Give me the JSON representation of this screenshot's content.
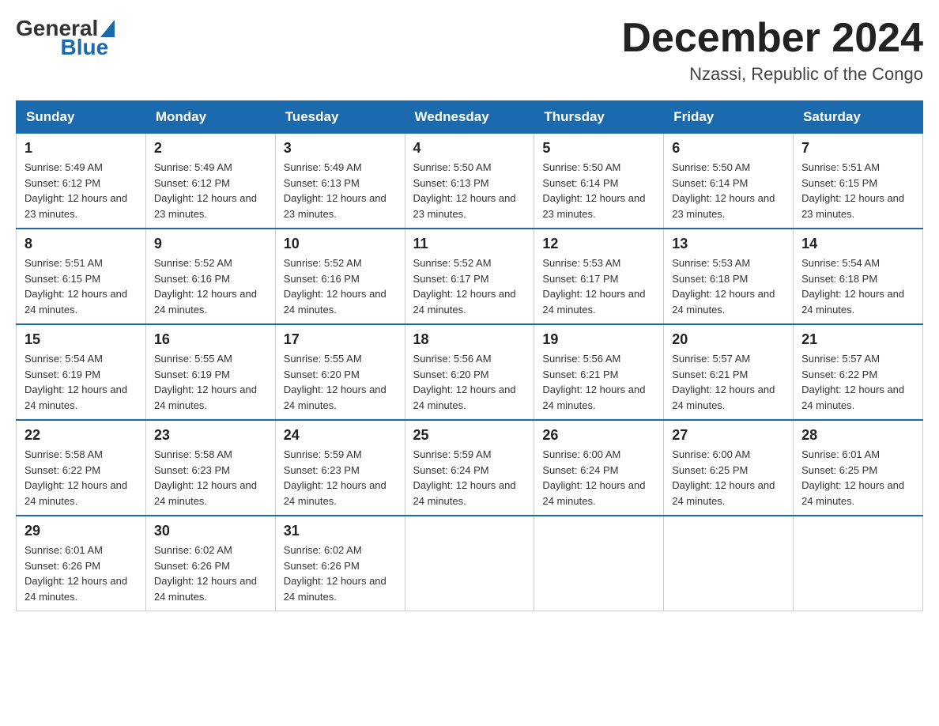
{
  "logo": {
    "general": "General",
    "blue": "Blue"
  },
  "header": {
    "month": "December 2024",
    "location": "Nzassi, Republic of the Congo"
  },
  "weekdays": [
    "Sunday",
    "Monday",
    "Tuesday",
    "Wednesday",
    "Thursday",
    "Friday",
    "Saturday"
  ],
  "weeks": [
    [
      {
        "day": "1",
        "sunrise": "5:49 AM",
        "sunset": "6:12 PM",
        "daylight": "12 hours and 23 minutes."
      },
      {
        "day": "2",
        "sunrise": "5:49 AM",
        "sunset": "6:12 PM",
        "daylight": "12 hours and 23 minutes."
      },
      {
        "day": "3",
        "sunrise": "5:49 AM",
        "sunset": "6:13 PM",
        "daylight": "12 hours and 23 minutes."
      },
      {
        "day": "4",
        "sunrise": "5:50 AM",
        "sunset": "6:13 PM",
        "daylight": "12 hours and 23 minutes."
      },
      {
        "day": "5",
        "sunrise": "5:50 AM",
        "sunset": "6:14 PM",
        "daylight": "12 hours and 23 minutes."
      },
      {
        "day": "6",
        "sunrise": "5:50 AM",
        "sunset": "6:14 PM",
        "daylight": "12 hours and 23 minutes."
      },
      {
        "day": "7",
        "sunrise": "5:51 AM",
        "sunset": "6:15 PM",
        "daylight": "12 hours and 23 minutes."
      }
    ],
    [
      {
        "day": "8",
        "sunrise": "5:51 AM",
        "sunset": "6:15 PM",
        "daylight": "12 hours and 24 minutes."
      },
      {
        "day": "9",
        "sunrise": "5:52 AM",
        "sunset": "6:16 PM",
        "daylight": "12 hours and 24 minutes."
      },
      {
        "day": "10",
        "sunrise": "5:52 AM",
        "sunset": "6:16 PM",
        "daylight": "12 hours and 24 minutes."
      },
      {
        "day": "11",
        "sunrise": "5:52 AM",
        "sunset": "6:17 PM",
        "daylight": "12 hours and 24 minutes."
      },
      {
        "day": "12",
        "sunrise": "5:53 AM",
        "sunset": "6:17 PM",
        "daylight": "12 hours and 24 minutes."
      },
      {
        "day": "13",
        "sunrise": "5:53 AM",
        "sunset": "6:18 PM",
        "daylight": "12 hours and 24 minutes."
      },
      {
        "day": "14",
        "sunrise": "5:54 AM",
        "sunset": "6:18 PM",
        "daylight": "12 hours and 24 minutes."
      }
    ],
    [
      {
        "day": "15",
        "sunrise": "5:54 AM",
        "sunset": "6:19 PM",
        "daylight": "12 hours and 24 minutes."
      },
      {
        "day": "16",
        "sunrise": "5:55 AM",
        "sunset": "6:19 PM",
        "daylight": "12 hours and 24 minutes."
      },
      {
        "day": "17",
        "sunrise": "5:55 AM",
        "sunset": "6:20 PM",
        "daylight": "12 hours and 24 minutes."
      },
      {
        "day": "18",
        "sunrise": "5:56 AM",
        "sunset": "6:20 PM",
        "daylight": "12 hours and 24 minutes."
      },
      {
        "day": "19",
        "sunrise": "5:56 AM",
        "sunset": "6:21 PM",
        "daylight": "12 hours and 24 minutes."
      },
      {
        "day": "20",
        "sunrise": "5:57 AM",
        "sunset": "6:21 PM",
        "daylight": "12 hours and 24 minutes."
      },
      {
        "day": "21",
        "sunrise": "5:57 AM",
        "sunset": "6:22 PM",
        "daylight": "12 hours and 24 minutes."
      }
    ],
    [
      {
        "day": "22",
        "sunrise": "5:58 AM",
        "sunset": "6:22 PM",
        "daylight": "12 hours and 24 minutes."
      },
      {
        "day": "23",
        "sunrise": "5:58 AM",
        "sunset": "6:23 PM",
        "daylight": "12 hours and 24 minutes."
      },
      {
        "day": "24",
        "sunrise": "5:59 AM",
        "sunset": "6:23 PM",
        "daylight": "12 hours and 24 minutes."
      },
      {
        "day": "25",
        "sunrise": "5:59 AM",
        "sunset": "6:24 PM",
        "daylight": "12 hours and 24 minutes."
      },
      {
        "day": "26",
        "sunrise": "6:00 AM",
        "sunset": "6:24 PM",
        "daylight": "12 hours and 24 minutes."
      },
      {
        "day": "27",
        "sunrise": "6:00 AM",
        "sunset": "6:25 PM",
        "daylight": "12 hours and 24 minutes."
      },
      {
        "day": "28",
        "sunrise": "6:01 AM",
        "sunset": "6:25 PM",
        "daylight": "12 hours and 24 minutes."
      }
    ],
    [
      {
        "day": "29",
        "sunrise": "6:01 AM",
        "sunset": "6:26 PM",
        "daylight": "12 hours and 24 minutes."
      },
      {
        "day": "30",
        "sunrise": "6:02 AM",
        "sunset": "6:26 PM",
        "daylight": "12 hours and 24 minutes."
      },
      {
        "day": "31",
        "sunrise": "6:02 AM",
        "sunset": "6:26 PM",
        "daylight": "12 hours and 24 minutes."
      },
      null,
      null,
      null,
      null
    ]
  ],
  "labels": {
    "sunrise_prefix": "Sunrise: ",
    "sunset_prefix": "Sunset: ",
    "daylight_prefix": "Daylight: "
  }
}
